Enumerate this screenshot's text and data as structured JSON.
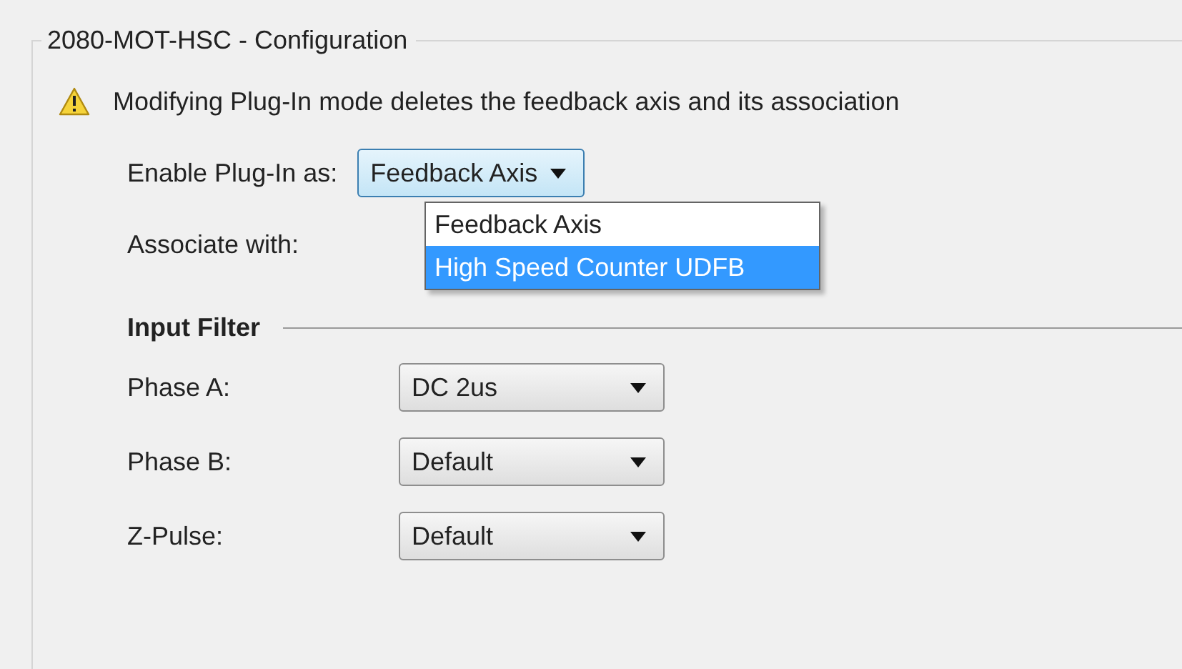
{
  "group": {
    "title": "2080-MOT-HSC - Configuration"
  },
  "warning": {
    "text": "Modifying Plug-In mode deletes the feedback axis and its association"
  },
  "plugin": {
    "label": "Enable Plug-In as:",
    "value": "Feedback Axis",
    "expanded": true,
    "options": [
      {
        "label": "Feedback Axis",
        "highlighted": false
      },
      {
        "label": "High Speed Counter UDFB",
        "highlighted": true
      }
    ]
  },
  "associate": {
    "label": "Associate with:"
  },
  "input_filter": {
    "title": "Input Filter",
    "rows": [
      {
        "label": "Phase A:",
        "value": "DC 2us"
      },
      {
        "label": "Phase B:",
        "value": "Default"
      },
      {
        "label": "Z-Pulse:",
        "value": "Default"
      }
    ]
  }
}
